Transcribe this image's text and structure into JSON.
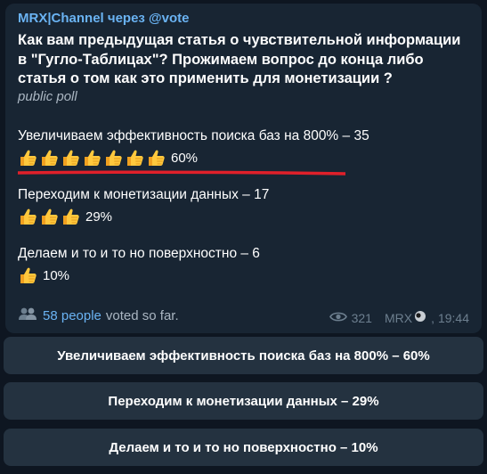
{
  "message": {
    "sender": "MRX|Channel через @vote",
    "question": "Как вам предыдущая статья о чувствительной информации в \"Гугло-Таблицах\"? Прожимаем вопрос до конца либо статья о том как это применить для монетизации ?",
    "poll_type": "public poll",
    "options": [
      {
        "text": "Увеличиваем эффективность поиска баз на 800% – 35",
        "percent_label": "60%",
        "thumbs": 7
      },
      {
        "text": "Переходим к монетизации данных – 17",
        "percent_label": "29%",
        "thumbs": 3
      },
      {
        "text": "Делаем и то и то но поверхностно – 6",
        "percent_label": "10%",
        "thumbs": 1
      }
    ],
    "voters_link": "58 people",
    "voters_suffix": "voted so far.",
    "views": "321",
    "author": "MRX",
    "time": "19:44"
  },
  "buttons": [
    {
      "label": "Увеличиваем эффективность поиска баз на 800% – 60%"
    },
    {
      "label": "Переходим к монетизации данных – 29%"
    },
    {
      "label": "Делаем и то и то но поверхностно – 10%"
    }
  ],
  "colors": {
    "background": "#0e1621",
    "bubble": "#182533",
    "accent": "#6ab3f3",
    "underline": "#e0202a",
    "button": "#243240"
  }
}
